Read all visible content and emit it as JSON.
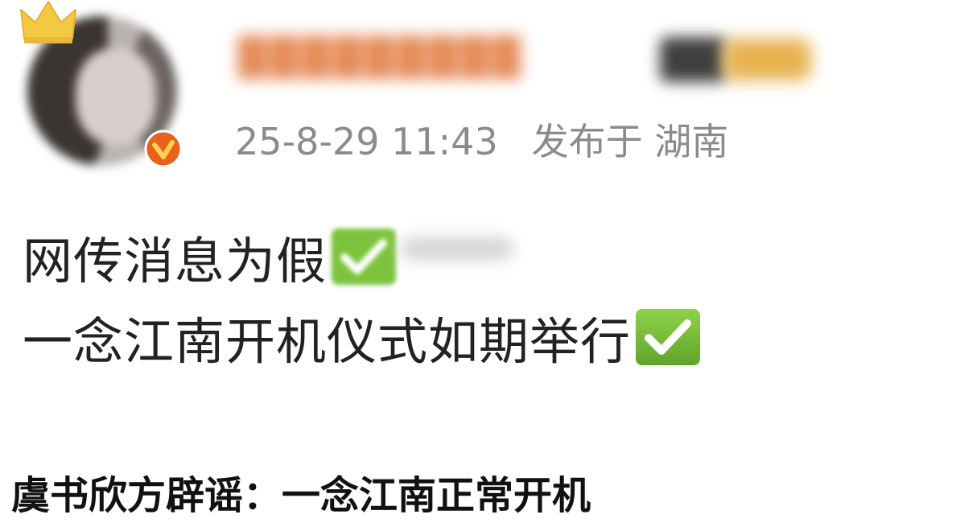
{
  "post": {
    "author": {
      "name_redacted": "█████████",
      "avatar_icon": "avatar-photo",
      "crown_icon": "crown-icon",
      "verified_icon": "verified-badge-icon"
    },
    "meta": {
      "timestamp": "25-8-29 11:43",
      "location": "发布于 湖南"
    },
    "body": {
      "line1": "网传消息为假",
      "line2": "一念江南开机仪式如期举行",
      "emoji": "white-heavy-check-mark"
    }
  },
  "caption": "虞书欣方辟谣：一念江南正常开机",
  "colors": {
    "username": "#e58a57",
    "meta": "#8b8b8b",
    "body_text": "#222222",
    "check_bg": "#7cc33d",
    "verified": "#e8621c",
    "crown": "#f3c843"
  }
}
